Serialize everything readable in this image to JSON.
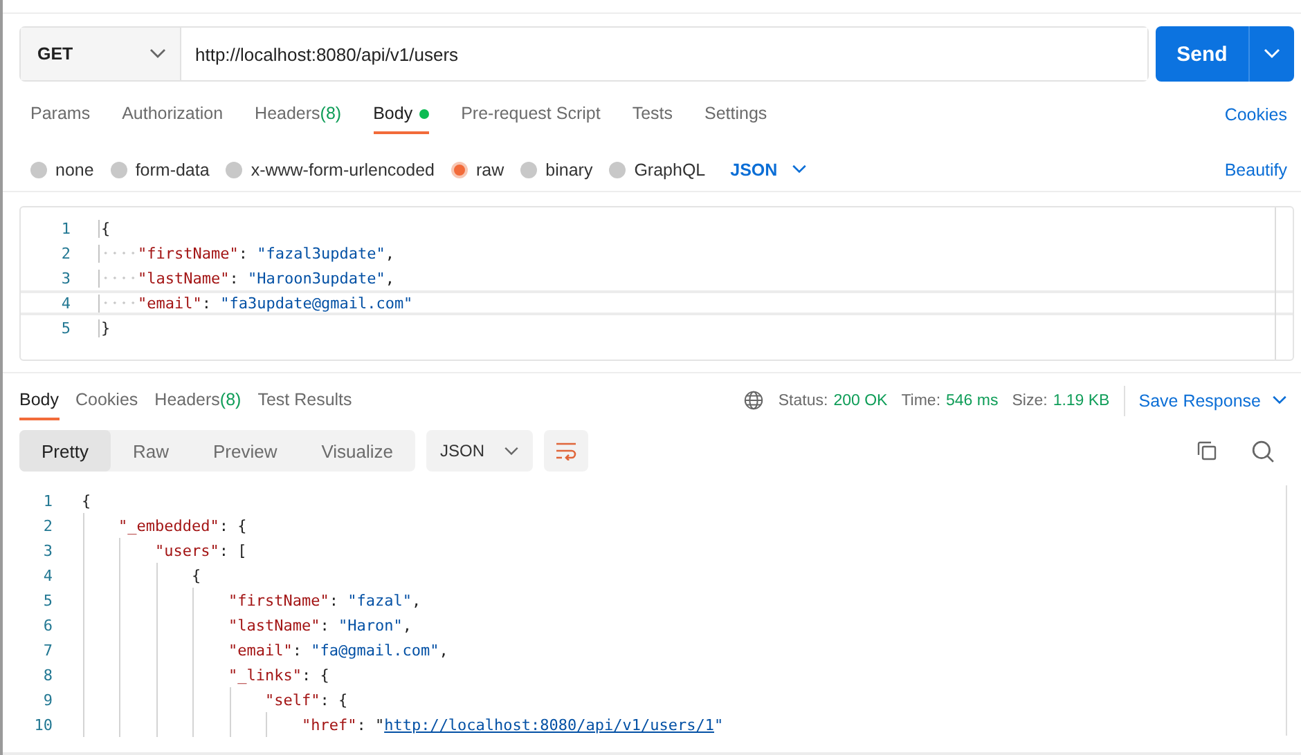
{
  "request": {
    "method": "GET",
    "url": "http://localhost:8080/api/v1/users",
    "send": "Send"
  },
  "request_tabs": [
    {
      "label": "Params",
      "selected": false
    },
    {
      "label": "Authorization",
      "selected": false
    },
    {
      "label": "Headers",
      "count": "(8)",
      "selected": false
    },
    {
      "label": "Body",
      "dot": true,
      "selected": true
    },
    {
      "label": "Pre-request Script",
      "selected": false
    },
    {
      "label": "Tests",
      "selected": false
    },
    {
      "label": "Settings",
      "selected": false
    }
  ],
  "cookies_link": "Cookies",
  "body_types": [
    {
      "label": "none",
      "selected": false
    },
    {
      "label": "form-data",
      "selected": false
    },
    {
      "label": "x-www-form-urlencoded",
      "selected": false
    },
    {
      "label": "raw",
      "selected": true
    },
    {
      "label": "binary",
      "selected": false
    },
    {
      "label": "GraphQL",
      "selected": false
    }
  ],
  "body_format": "JSON",
  "beautify": "Beautify",
  "request_body": [
    {
      "number": "1",
      "current": false,
      "tokens": [
        {
          "kind": "punct",
          "text": "{"
        }
      ]
    },
    {
      "number": "2",
      "current": false,
      "tokens": [
        {
          "kind": "key",
          "text": "    \"firstName\""
        },
        {
          "kind": "punct",
          "text": ": "
        },
        {
          "kind": "string",
          "text": "\"fazal3update\""
        },
        {
          "kind": "punct",
          "text": ","
        }
      ]
    },
    {
      "number": "3",
      "current": false,
      "tokens": [
        {
          "kind": "key",
          "text": "    \"lastName\""
        },
        {
          "kind": "punct",
          "text": ": "
        },
        {
          "kind": "string",
          "text": "\"Haroon3update\""
        },
        {
          "kind": "punct",
          "text": ","
        }
      ]
    },
    {
      "number": "4",
      "current": true,
      "tokens": [
        {
          "kind": "key",
          "text": "    \"email\""
        },
        {
          "kind": "punct",
          "text": ": "
        },
        {
          "kind": "string",
          "text": "\"fa3update@gmail.com\""
        }
      ]
    },
    {
      "number": "5",
      "current": false,
      "tokens": [
        {
          "kind": "punct",
          "text": "}"
        }
      ]
    }
  ],
  "response_tabs": [
    {
      "label": "Body",
      "selected": true
    },
    {
      "label": "Cookies",
      "selected": false
    },
    {
      "label": "Headers",
      "count": "(8)",
      "selected": false
    },
    {
      "label": "Test Results",
      "selected": false
    }
  ],
  "status": [
    {
      "label": "Status:",
      "value": "200 OK"
    },
    {
      "label": "Time:",
      "value": "546 ms"
    },
    {
      "label": "Size:",
      "value": "1.19 KB"
    }
  ],
  "save_response": "Save Response",
  "view_modes": [
    {
      "label": "Pretty",
      "selected": true
    },
    {
      "label": "Raw",
      "selected": false
    },
    {
      "label": "Preview",
      "selected": false
    },
    {
      "label": "Visualize",
      "selected": false
    }
  ],
  "response_format": "JSON",
  "response_body": [
    {
      "number": "1",
      "tokens": [
        {
          "kind": "punct",
          "text": "{"
        }
      ]
    },
    {
      "number": "2",
      "tokens": [
        {
          "kind": "key",
          "text": "    \"_embedded\""
        },
        {
          "kind": "punct",
          "text": ": {"
        }
      ]
    },
    {
      "number": "3",
      "tokens": [
        {
          "kind": "key",
          "text": "        \"users\""
        },
        {
          "kind": "punct",
          "text": ": ["
        }
      ]
    },
    {
      "number": "4",
      "tokens": [
        {
          "kind": "punct",
          "text": "            {"
        }
      ]
    },
    {
      "number": "5",
      "tokens": [
        {
          "kind": "key",
          "text": "                \"firstName\""
        },
        {
          "kind": "punct",
          "text": ": "
        },
        {
          "kind": "string",
          "text": "\"fazal\""
        },
        {
          "kind": "punct",
          "text": ","
        }
      ]
    },
    {
      "number": "6",
      "tokens": [
        {
          "kind": "key",
          "text": "                \"lastName\""
        },
        {
          "kind": "punct",
          "text": ": "
        },
        {
          "kind": "string",
          "text": "\"Haron\""
        },
        {
          "kind": "punct",
          "text": ","
        }
      ]
    },
    {
      "number": "7",
      "tokens": [
        {
          "kind": "key",
          "text": "                \"email\""
        },
        {
          "kind": "punct",
          "text": ": "
        },
        {
          "kind": "string",
          "text": "\"fa@gmail.com\""
        },
        {
          "kind": "punct",
          "text": ","
        }
      ]
    },
    {
      "number": "8",
      "tokens": [
        {
          "kind": "key",
          "text": "                \"_links\""
        },
        {
          "kind": "punct",
          "text": ": {"
        }
      ]
    },
    {
      "number": "9",
      "tokens": [
        {
          "kind": "key",
          "text": "                    \"self\""
        },
        {
          "kind": "punct",
          "text": ": {"
        }
      ]
    },
    {
      "number": "10",
      "tokens": [
        {
          "kind": "key",
          "text": "                        \"href\""
        },
        {
          "kind": "punct",
          "text": ": \""
        },
        {
          "kind": "link",
          "text": "http://localhost:8080/api/v1/users/1"
        },
        {
          "kind": "string",
          "text": "\""
        }
      ]
    }
  ]
}
